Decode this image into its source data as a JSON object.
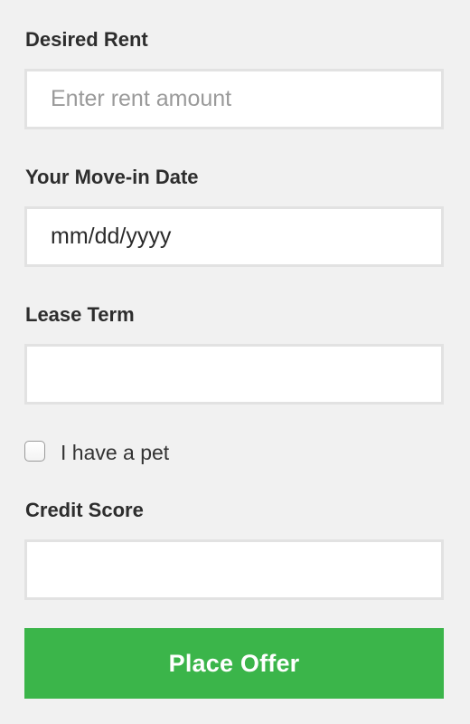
{
  "form": {
    "desired_rent": {
      "label": "Desired Rent",
      "placeholder": "Enter rent amount",
      "value": ""
    },
    "move_in_date": {
      "label": "Your Move-in Date",
      "value": "mm/dd/yyyy"
    },
    "lease_term": {
      "label": "Lease Term",
      "value": ""
    },
    "pet": {
      "label": "I have a pet",
      "checked": false
    },
    "credit_score": {
      "label": "Credit Score",
      "value": ""
    },
    "submit_label": "Place Offer"
  },
  "colors": {
    "background": "#f1f1f1",
    "field_border": "#e2e2e2",
    "button": "#3bb54a",
    "button_text": "#ffffff"
  }
}
